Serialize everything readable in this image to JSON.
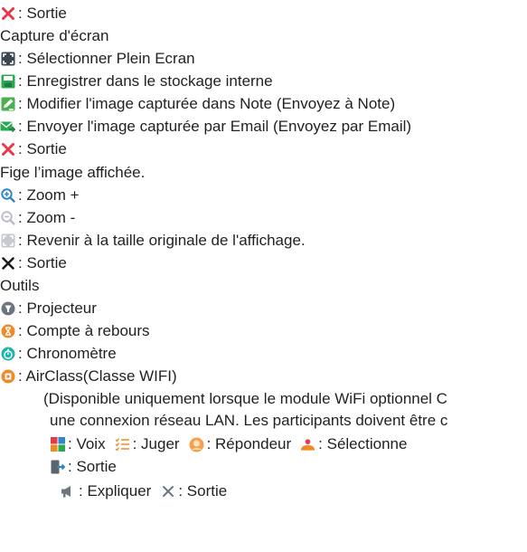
{
  "exit_top": {
    "text": ": Sortie",
    "icon": "red-x-icon",
    "color": "#e8394a"
  },
  "capture_heading": "Capture d'écran",
  "capture_items": [
    {
      "icon": "full-screen-select-icon",
      "text": ": Sélectionner Plein Ecran"
    },
    {
      "icon": "save-disk-icon",
      "text": ": Enregistrer dans le stockage interne"
    },
    {
      "icon": "edit-note-icon",
      "text": ": Modifier l'image capturée dans Note (Envoyez à Note)"
    },
    {
      "icon": "email-send-icon",
      "text": ": Envoyer l'image capturée par Email (Envoyez par Email)"
    },
    {
      "icon": "red-x-icon",
      "text": ": Sortie"
    }
  ],
  "freeze_heading": "Fige l’image affichée.",
  "freeze_items": [
    {
      "icon": "zoom-in-icon",
      "text": ": Zoom +"
    },
    {
      "icon": "zoom-out-icon",
      "text": ": Zoom -"
    },
    {
      "icon": "original-size-icon",
      "text": ": Revenir à la taille originale de l'affichage."
    },
    {
      "icon": "black-x-icon",
      "text": ": Sortie"
    }
  ],
  "tools_heading": "Outils",
  "tools_items": [
    {
      "icon": "projector-icon",
      "text": ": Projecteur"
    },
    {
      "icon": "hourglass-icon",
      "text": ": Compte à rebours"
    },
    {
      "icon": "stopwatch-icon",
      "text": ": Chronomètre"
    },
    {
      "icon": "airclass-icon",
      "text": ": AirClass(Classe WIFI)"
    }
  ],
  "airclass_note_1": "(Disponible uniquement lorsque le module WiFi optionnel C",
  "airclass_note_2": "une connexion réseau LAN. Les participants doivent être c",
  "airclass_buttons": [
    {
      "icon": "voice-abcd-icon",
      "text": ": Voix"
    },
    {
      "icon": "judge-list-icon",
      "text": ": Juger"
    },
    {
      "icon": "responder-icon",
      "text": ": Répondeur"
    },
    {
      "icon": "select-person-icon",
      "text": ": Sélectionne"
    }
  ],
  "airclass_exit": {
    "icon": "exit-door-icon",
    "text": ": Sortie"
  },
  "explain_items": [
    {
      "icon": "megaphone-icon",
      "text": ": Expliquer"
    },
    {
      "icon": "gray-x-icon",
      "text": ": Sortie"
    }
  ],
  "colors": {
    "red": "#e8394a",
    "blue": "#2f86c8",
    "green": "#2aa952",
    "orange": "#f08a24",
    "teal": "#1fb3a9",
    "gray": "#b9bec4"
  }
}
